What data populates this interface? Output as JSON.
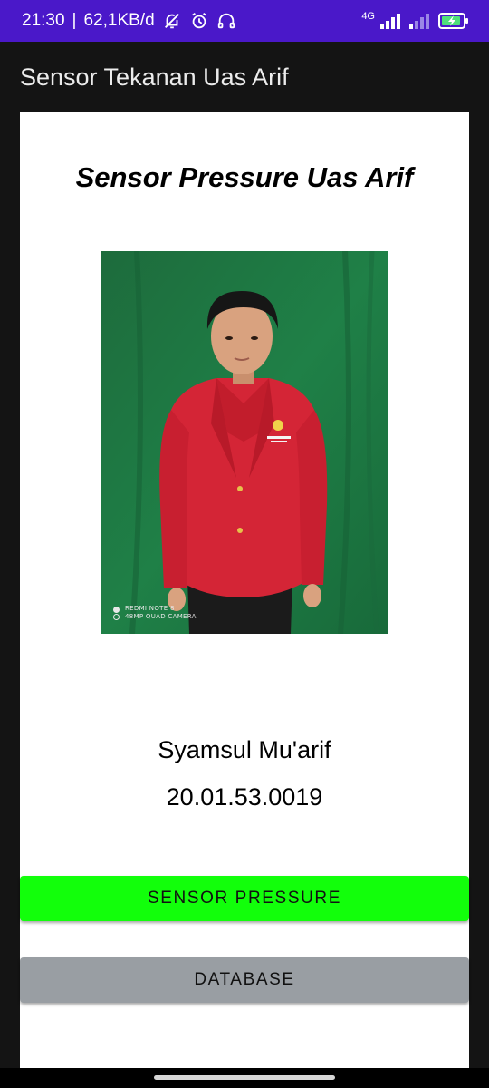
{
  "status_bar": {
    "time": "21:30",
    "separator": "|",
    "network_speed": "62,1KB/d",
    "network_type": "4G",
    "icons": [
      "notifications-off-icon",
      "alarm-icon",
      "headset-icon",
      "signal-icon",
      "signal-icon",
      "battery-charging-icon"
    ],
    "background_color": "#4a18c9"
  },
  "app_bar": {
    "title": "Sensor Tekanan Uas Arif"
  },
  "main": {
    "heading": "Sensor Pressure Uas Arif",
    "photo": {
      "watermark_line1": "REDMI NOTE 8",
      "watermark_line2": "48MP QUAD CAMERA"
    },
    "name": "Syamsul Mu'arif",
    "student_id": "20.01.53.0019"
  },
  "buttons": {
    "sensor_label": "SENSOR PRESSURE",
    "sensor_color": "#12ff0b",
    "database_label": "DATABASE",
    "database_color": "#999ea3"
  }
}
